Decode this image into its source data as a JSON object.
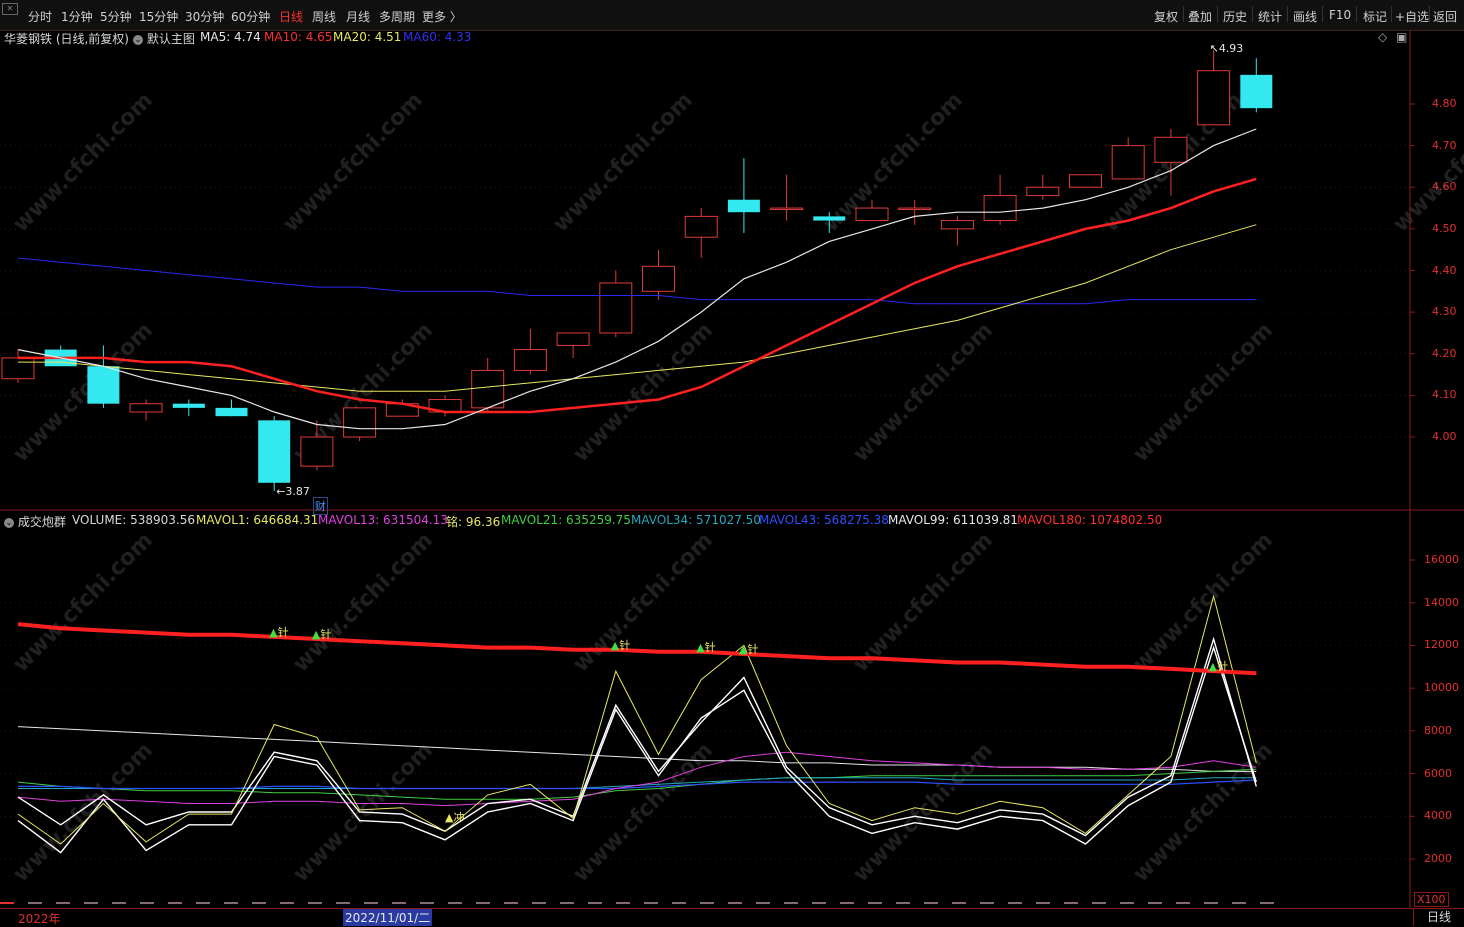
{
  "toolbar": {
    "periods": [
      "分时",
      "1分钟",
      "5分钟",
      "15分钟",
      "30分钟",
      "60分钟",
      "日线",
      "周线",
      "月线",
      "多周期",
      "更多 〉"
    ],
    "active_period": "日线",
    "right_buttons": [
      "复权",
      "叠加",
      "历史",
      "统计",
      "画线",
      "F10",
      "标记",
      "+自选",
      "返回"
    ]
  },
  "main_legend": {
    "stock": "华菱钢铁 (日线,前复权)",
    "template": "默认主图",
    "ma5": "MA5: 4.74",
    "ma10": "MA10: 4.65",
    "ma20": "MA20: 4.51",
    "ma60": "MA60: 4.33"
  },
  "colors": {
    "up": "#e23a3a",
    "down": "#34e8f0",
    "ma5": "#e8e8e8",
    "ma10": "#ff2020",
    "ma20": "#e8e860",
    "ma60": "#2a2af0",
    "mavol13": "#e040e0",
    "mavol21": "#40d040",
    "mavol34": "#20a8c0",
    "mavol43": "#3050ff",
    "mavol180": "#ff2020",
    "axis": "#8b1a1a"
  },
  "price_axis": [
    "4.80",
    "4.70",
    "4.60",
    "4.50",
    "4.40",
    "4.30",
    "4.20",
    "4.10",
    "4.00"
  ],
  "annotations": {
    "high": "4.93",
    "low": "3.87",
    "cai": "财",
    "chong": "冲",
    "zhen": "针"
  },
  "vol_legend": {
    "name": "成交炮群",
    "volume": "VOLUME: 538903.56",
    "mavol1": "MAVOL1: 646684.31",
    "mavol13": "MAVOL13: 631504.13",
    "ming": "铭: 96.36",
    "mavol21": "MAVOL21: 635259.75",
    "mavol34": "MAVOL34: 571027.50",
    "mavol43": "MAVOL43: 568275.38",
    "mavol99": "MAVOL99: 611039.81",
    "mavol180": "MAVOL180: 1074802.50"
  },
  "vol_axis": [
    "16000",
    "14000",
    "12000",
    "10000",
    "8000",
    "6000",
    "4000",
    "2000"
  ],
  "vol_unit": "X100",
  "bottom": {
    "year": "2022年",
    "date": "2022/11/01/二",
    "period": "日线"
  },
  "watermark": "www.cfchi.com",
  "chart_data": {
    "type": "candlestick",
    "ohlc": [
      {
        "o": 4.14,
        "h": 4.21,
        "l": 4.13,
        "c": 4.19
      },
      {
        "o": 4.21,
        "h": 4.22,
        "l": 4.17,
        "c": 4.17
      },
      {
        "o": 4.17,
        "h": 4.22,
        "l": 4.07,
        "c": 4.08
      },
      {
        "o": 4.06,
        "h": 4.09,
        "l": 4.04,
        "c": 4.08
      },
      {
        "o": 4.08,
        "h": 4.09,
        "l": 4.05,
        "c": 4.07
      },
      {
        "o": 4.07,
        "h": 4.09,
        "l": 4.05,
        "c": 4.05
      },
      {
        "o": 4.04,
        "h": 4.05,
        "l": 3.87,
        "c": 3.89
      },
      {
        "o": 3.93,
        "h": 4.04,
        "l": 3.92,
        "c": 4.0
      },
      {
        "o": 4.0,
        "h": 4.07,
        "l": 3.99,
        "c": 4.07
      },
      {
        "o": 4.05,
        "h": 4.09,
        "l": 4.05,
        "c": 4.08
      },
      {
        "o": 4.06,
        "h": 4.1,
        "l": 4.05,
        "c": 4.09
      },
      {
        "o": 4.07,
        "h": 4.19,
        "l": 4.06,
        "c": 4.16
      },
      {
        "o": 4.16,
        "h": 4.26,
        "l": 4.15,
        "c": 4.21
      },
      {
        "o": 4.22,
        "h": 4.25,
        "l": 4.19,
        "c": 4.25
      },
      {
        "o": 4.25,
        "h": 4.4,
        "l": 4.24,
        "c": 4.37
      },
      {
        "o": 4.35,
        "h": 4.45,
        "l": 4.33,
        "c": 4.41
      },
      {
        "o": 4.48,
        "h": 4.55,
        "l": 4.43,
        "c": 4.53
      },
      {
        "o": 4.57,
        "h": 4.67,
        "l": 4.49,
        "c": 4.54
      },
      {
        "o": 4.55,
        "h": 4.63,
        "l": 4.52,
        "c": 4.55
      },
      {
        "o": 4.53,
        "h": 4.54,
        "l": 4.49,
        "c": 4.52
      },
      {
        "o": 4.52,
        "h": 4.57,
        "l": 4.52,
        "c": 4.55
      },
      {
        "o": 4.55,
        "h": 4.57,
        "l": 4.51,
        "c": 4.55
      },
      {
        "o": 4.5,
        "h": 4.53,
        "l": 4.46,
        "c": 4.52
      },
      {
        "o": 4.52,
        "h": 4.63,
        "l": 4.51,
        "c": 4.58
      },
      {
        "o": 4.58,
        "h": 4.63,
        "l": 4.57,
        "c": 4.6
      },
      {
        "o": 4.6,
        "h": 4.61,
        "l": 4.6,
        "c": 4.63
      },
      {
        "o": 4.62,
        "h": 4.72,
        "l": 4.62,
        "c": 4.7
      },
      {
        "o": 4.66,
        "h": 4.74,
        "l": 4.58,
        "c": 4.72
      },
      {
        "o": 4.75,
        "h": 4.93,
        "l": 4.75,
        "c": 4.88
      },
      {
        "o": 4.87,
        "h": 4.91,
        "l": 4.78,
        "c": 4.79
      }
    ],
    "ma5": [
      4.21,
      4.19,
      4.17,
      4.14,
      4.12,
      4.1,
      4.06,
      4.03,
      4.02,
      4.02,
      4.03,
      4.07,
      4.11,
      4.14,
      4.18,
      4.23,
      4.3,
      4.38,
      4.42,
      4.47,
      4.5,
      4.53,
      4.54,
      4.54,
      4.55,
      4.57,
      4.6,
      4.64,
      4.7,
      4.74
    ],
    "ma10": [
      4.19,
      4.19,
      4.19,
      4.18,
      4.18,
      4.17,
      4.14,
      4.11,
      4.09,
      4.08,
      4.06,
      4.06,
      4.06,
      4.07,
      4.08,
      4.09,
      4.12,
      4.17,
      4.22,
      4.27,
      4.32,
      4.37,
      4.41,
      4.44,
      4.47,
      4.5,
      4.52,
      4.55,
      4.59,
      4.62,
      4.65
    ],
    "ma20": [
      4.18,
      4.18,
      4.17,
      4.16,
      4.15,
      4.14,
      4.13,
      4.12,
      4.11,
      4.11,
      4.11,
      4.12,
      4.13,
      4.14,
      4.15,
      4.16,
      4.17,
      4.18,
      4.2,
      4.22,
      4.24,
      4.26,
      4.28,
      4.31,
      4.34,
      4.37,
      4.41,
      4.45,
      4.48,
      4.51
    ],
    "ma60": [
      4.43,
      4.42,
      4.41,
      4.4,
      4.39,
      4.38,
      4.37,
      4.36,
      4.36,
      4.35,
      4.35,
      4.35,
      4.34,
      4.34,
      4.34,
      4.34,
      4.33,
      4.33,
      4.33,
      4.33,
      4.33,
      4.32,
      4.32,
      4.32,
      4.32,
      4.32,
      4.33,
      4.33,
      4.33,
      4.33
    ],
    "volume": [
      4900,
      3600,
      5000,
      3600,
      4200,
      4200,
      7000,
      6600,
      4200,
      4100,
      3300,
      4600,
      4800,
      4000,
      9200,
      6100,
      8400,
      10500,
      6300,
      4400,
      3600,
      4000,
      3700,
      4300,
      4100,
      3100,
      4900,
      5900,
      12300,
      5400
    ],
    "mavol_white": [
      3800,
      2300,
      4800,
      2400,
      3600,
      3600,
      6800,
      6400,
      3800,
      3700,
      2900,
      4200,
      4600,
      3800,
      9000,
      5900,
      8600,
      9900,
      6100,
      4000,
      3200,
      3700,
      3400,
      4000,
      3800,
      2700,
      4500,
      5600,
      11900,
      5600
    ],
    "mavol1": [
      4100,
      2700,
      4600,
      2800,
      4100,
      4100,
      8300,
      7700,
      4300,
      4400,
      3300,
      5000,
      5500,
      3900,
      10800,
      6900,
      10400,
      12000,
      7300,
      4600,
      3800,
      4400,
      4100,
      4700,
      4400,
      3200,
      5000,
      6800,
      14300,
      6500
    ],
    "mavol13": [
      4900,
      4700,
      4800,
      4700,
      4600,
      4600,
      4700,
      4700,
      4600,
      4600,
      4500,
      4600,
      4700,
      4800,
      5300,
      5600,
      6300,
      6800,
      7000,
      6800,
      6600,
      6500,
      6400,
      6300,
      6300,
      6200,
      6200,
      6300,
      6600,
      6300
    ],
    "mavol21": [
      5600,
      5400,
      5300,
      5200,
      5200,
      5200,
      5100,
      5100,
      5000,
      4900,
      4800,
      4800,
      4800,
      4900,
      5200,
      5300,
      5500,
      5700,
      5800,
      5800,
      5900,
      5900,
      5900,
      5900,
      5900,
      5900,
      5900,
      6000,
      6100,
      6200
    ],
    "mavol34": [
      5300,
      5300,
      5300,
      5300,
      5300,
      5300,
      5300,
      5300,
      5300,
      5300,
      5300,
      5300,
      5300,
      5300,
      5400,
      5500,
      5600,
      5700,
      5800,
      5800,
      5800,
      5800,
      5700,
      5700,
      5700,
      5700,
      5700,
      5700,
      5800,
      5800
    ],
    "mavol43": [
      5400,
      5400,
      5300,
      5300,
      5300,
      5300,
      5400,
      5400,
      5300,
      5300,
      5300,
      5300,
      5300,
      5300,
      5300,
      5400,
      5500,
      5600,
      5600,
      5600,
      5600,
      5600,
      5500,
      5500,
      5500,
      5500,
      5500,
      5500,
      5600,
      5700
    ],
    "mavol99": [
      8200,
      8100,
      8000,
      7900,
      7800,
      7700,
      7600,
      7500,
      7400,
      7300,
      7200,
      7100,
      7000,
      6900,
      6800,
      6700,
      6600,
      6600,
      6500,
      6500,
      6400,
      6400,
      6400,
      6300,
      6300,
      6300,
      6200,
      6200,
      6100,
      6100
    ],
    "mavol180": [
      13000,
      12800,
      12700,
      12600,
      12500,
      12500,
      12400,
      12300,
      12200,
      12100,
      12000,
      11900,
      11900,
      11800,
      11800,
      11700,
      11700,
      11600,
      11500,
      11400,
      11400,
      11300,
      11200,
      11200,
      11100,
      11000,
      11000,
      10900,
      10800,
      10700
    ]
  }
}
